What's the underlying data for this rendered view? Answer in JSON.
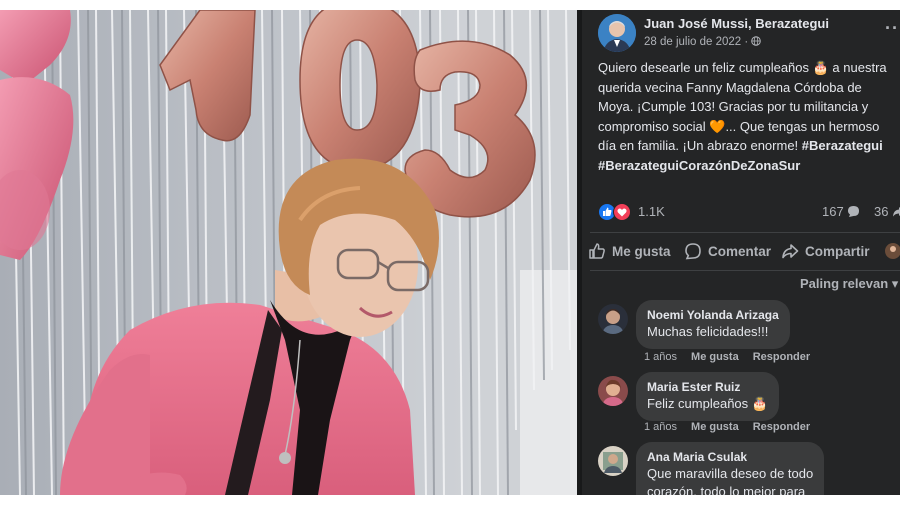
{
  "photo": {
    "description_alt": "",
    "balloon_numbers": [
      "1",
      "0",
      "3"
    ],
    "colors": {
      "balloon": "#c98a82",
      "sweater": "#e8708a",
      "scarf": "#1a1416",
      "curtain": "#c9ccd1"
    }
  },
  "post": {
    "author": "Juan José Mussi, Berazategui",
    "date": "28 de julio de 2022",
    "privacy_icon": "globe-icon",
    "more_icon": "more-options-icon",
    "text_lines": [
      "Quiero desearle un feliz cumpleaños 🎂 a nuestra",
      "querida vecina Fanny Magdalena Córdoba de",
      "Moya. ¡Cumple 103! Gracias por tu militancia y",
      "compromiso social 🧡... Que tengas un hermoso",
      "día en familia. ¡Un abrazo enorme!"
    ],
    "hashtag_inline": "#Berazategui",
    "hashtag_line": "#BerazateguiCorazónDeZonaSur",
    "reactions": {
      "count": "1.1K",
      "icons": [
        "like-icon",
        "love-icon"
      ]
    },
    "comments_count": "167",
    "shares_count": "36"
  },
  "actions": {
    "like": "Me gusta",
    "comment": "Comentar",
    "share": "Compartir"
  },
  "sort_label": "Paling relevan",
  "comments": [
    {
      "name": "Noemi Yolanda Arizaga",
      "text": "Muchas felicidades!!!",
      "age": "1 años",
      "like": "Me gusta",
      "reply": "Responder"
    },
    {
      "name": "Maria Ester Ruiz",
      "text": "Feliz cumpleaños 🎂",
      "age": "1 años",
      "like": "Me gusta",
      "reply": "Responder"
    },
    {
      "name": "Ana Maria Csulak",
      "text_lines": [
        "Que maravilla deseo de todo",
        "corazón, todo lo mejor para"
      ]
    }
  ],
  "theme": {
    "panel_bg": "#242526",
    "bubble_bg": "#3a3b3c",
    "text": "#e4e6eb",
    "muted": "#b0b3b8",
    "like_blue": "#1877f2",
    "love_red": "#f33e58"
  }
}
